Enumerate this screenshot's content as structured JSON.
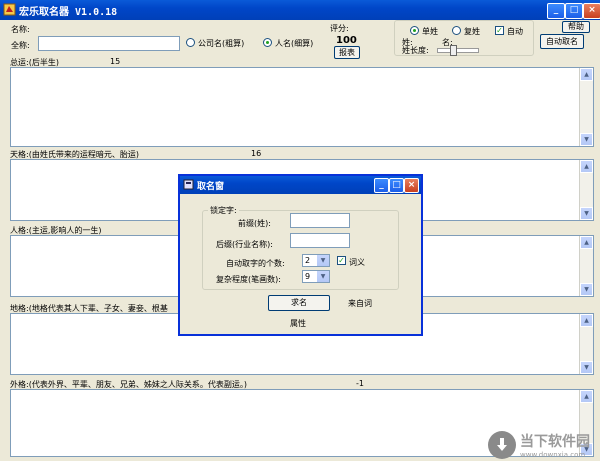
{
  "window": {
    "title": "宏乐取名器 V1.0.18",
    "minimize": "_",
    "maximize": "□",
    "close": "×"
  },
  "top": {
    "name_label": "名称:",
    "fullname_label": "全称:",
    "fullname_value": "",
    "radio_company": "公司名(粗算)",
    "radio_person": "人名(细算)",
    "score_label": "评分:",
    "score_value": "100",
    "report_button": "报表",
    "radio_single": "单姓",
    "radio_compound": "复姓",
    "auto_check": "自动",
    "surname_label": "姓:",
    "given_label": "名:",
    "surname_length_label": "姓长度:",
    "help_button": "帮助",
    "auto_name_button": "自动取名"
  },
  "sections": [
    {
      "label": "总运:(后半生)",
      "value": "15"
    },
    {
      "label": "天格:(由姓氏带来的运程暗元、胎运)",
      "value": "16"
    },
    {
      "label": "人格:(主运,影响人的一生)",
      "value": ""
    },
    {
      "label": "地格:(地格代表其人下辈、子女、妻妾、根基",
      "value": ""
    },
    {
      "label": "外格:(代表外界、平辈、朋友、兄弟、姊妹之人际关系。代表副运。)",
      "value": "-1"
    }
  ],
  "dialog": {
    "title": "取名窗",
    "group_label": "锁定字:",
    "prefix_label": "前缀(姓):",
    "prefix_value": "",
    "suffix_label": "后缀(行业名称):",
    "suffix_value": "",
    "count_label": "自动取字的个数:",
    "count_value": "2",
    "ci_check": "词义",
    "complexity_label": "复杂程度(笔画数):",
    "complexity_value": "9",
    "seek_button": "求名",
    "source_label": "来自词",
    "attr_label": "属性"
  },
  "watermark": {
    "brand": "当下软件园",
    "url": "www.downxia.com"
  }
}
